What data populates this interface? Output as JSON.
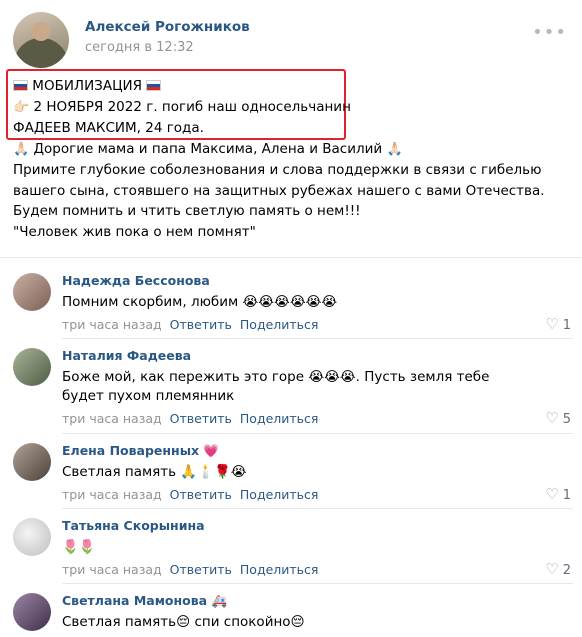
{
  "post": {
    "author": "Алексей Рогожников",
    "time": "сегодня в 12:32",
    "more": "•••",
    "line1": "МОБИЛИЗАЦИЯ",
    "line2": "2 НОЯБРЯ 2022 г. погиб наш односельчанин",
    "line3": "ФАДЕЕВ МАКСИМ, 24 года.",
    "line4": "Дорогие мама и папа Максима, Алена и Василий",
    "line5": "Примите глубокие соболезнования и слова поддержки в связи с гибелью вашего сына, стоявшего на защитных рубежах нашего с вами Отечества. Будем помнить и чтить светлую память о нем!!!",
    "line6": "\"Человек жив пока о нем помнят\"",
    "emoji_point": "👉🏻",
    "emoji_pray": "🙏🏻"
  },
  "comments": [
    {
      "name": "Надежда Бессонова",
      "text": "Помним скорбим, любим 😭😭😭😭😭😭",
      "time": "три часа назад",
      "reply": "Ответить",
      "share": "Поделиться",
      "likes": "1",
      "avatar_color": "#b89a8a"
    },
    {
      "name": "Наталия Фадеева",
      "text": "Боже мой, как пережить это горе 😭😭😭. Пусть земля тебе будет пухом племянник",
      "time": "три часа назад",
      "reply": "Ответить",
      "share": "Поделиться",
      "likes": "5",
      "avatar_color": "#7d8a6e"
    },
    {
      "name": "Елена Поваренных",
      "name_emoji": "💗",
      "text": "Светлая память 🙏🕯️🌹😭",
      "time": "три часа назад",
      "reply": "Ответить",
      "share": "Поделиться",
      "likes": "1",
      "avatar_color": "#8b7f74"
    },
    {
      "name": "Татьяна Скорынина",
      "text": "🌷🌷",
      "time": "три часа назад",
      "reply": "Ответить",
      "share": "Поделиться",
      "likes": "2",
      "avatar_color": "#d9d9d9"
    },
    {
      "name": "Светлана Мамонова",
      "name_emoji": "🚑",
      "text": "Светлая память😔 спи спокойно😔",
      "avatar_color": "#6e5a7a"
    }
  ],
  "colors": {
    "link": "#2a5885",
    "muted": "#939393",
    "highlight_border": "#e0212f"
  },
  "icons": {
    "heart": "heart-icon",
    "flag": "russia-flag-icon",
    "more": "more-dots-icon"
  }
}
